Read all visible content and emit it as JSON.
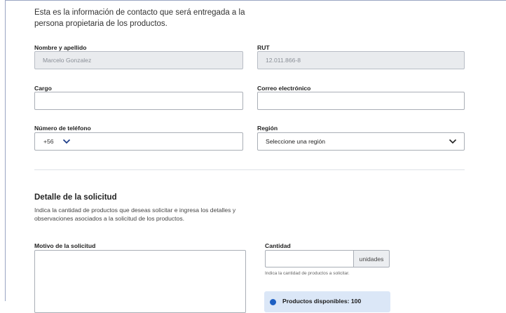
{
  "intro_text": "Esta es la información de contacto que será entregada a la persona propietaria de los productos.",
  "fields": {
    "nombre": {
      "label": "Nombre y apellido",
      "value": "Marcelo Gonzalez"
    },
    "rut": {
      "label": "RUT",
      "value": "12.011.866-8"
    },
    "cargo": {
      "label": "Cargo",
      "value": ""
    },
    "correo": {
      "label": "Correo electrónico",
      "value": ""
    },
    "telefono": {
      "label": "Número de teléfono",
      "prefix": "+56",
      "value": ""
    },
    "region": {
      "label": "Región",
      "selected": "Seleccione una región"
    }
  },
  "detalle": {
    "title": "Detalle de la solicitud",
    "description": "Indica la cantidad de productos que deseas solicitar e ingresa los detalles y observaciones asociados a la solicitud de los productos.",
    "motivo_label": "Motivo de la solicitud",
    "cantidad_label": "Cantidad",
    "cantidad_unit": "unidades",
    "cantidad_help": "Indica la cantidad de productos a solicitar.",
    "disponibles": "Productos disponibles: 100"
  },
  "colors": {
    "accent": "#1d5fc2",
    "info_bg": "#dbe7f7"
  },
  "icons": {
    "chevron": "chevron-down-icon",
    "info": "info-dot-icon"
  }
}
